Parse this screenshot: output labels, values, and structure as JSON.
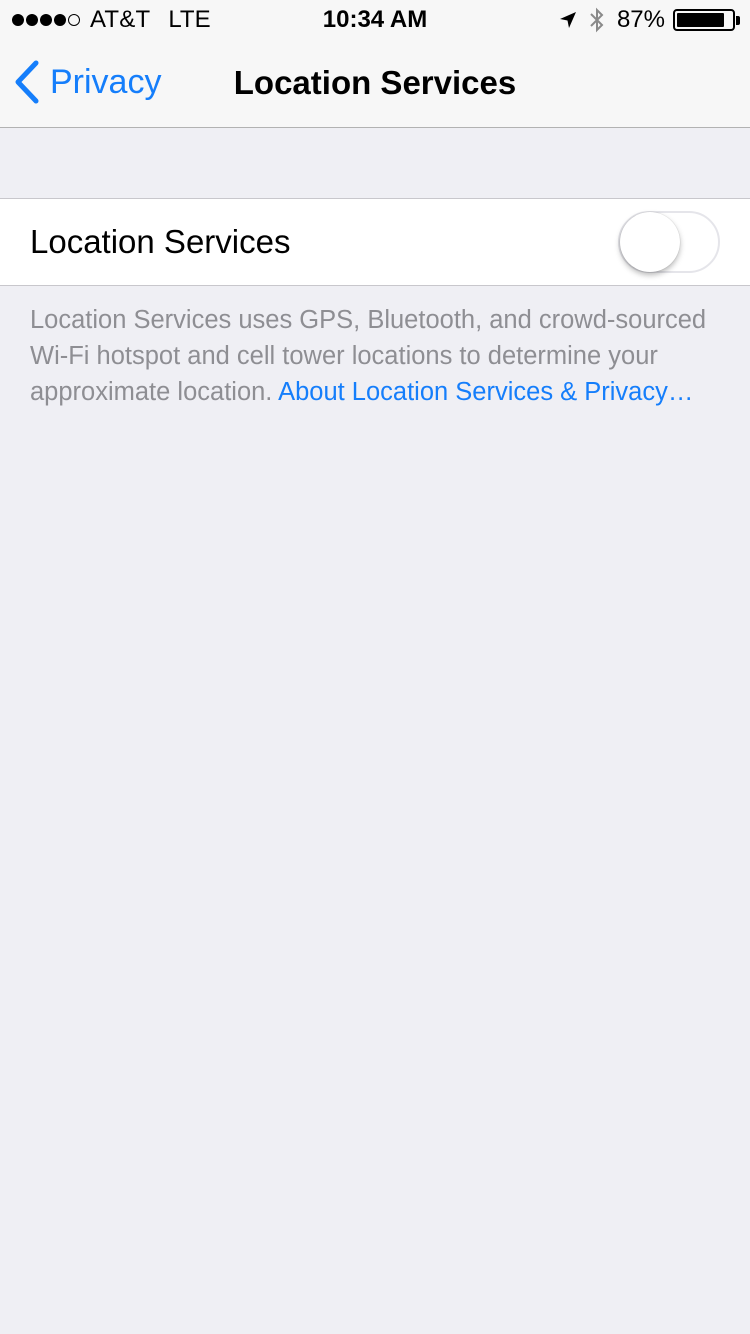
{
  "status_bar": {
    "signal_dots_filled": 4,
    "signal_dots_total": 5,
    "carrier": "AT&T",
    "network": "LTE",
    "time": "10:34 AM",
    "battery_percent_text": "87%",
    "battery_level": 0.87,
    "icons": [
      "location-arrow-icon",
      "bluetooth-icon",
      "battery-icon"
    ]
  },
  "nav": {
    "back_label": "Privacy",
    "title": "Location Services"
  },
  "setting": {
    "label": "Location Services",
    "toggle_on": false
  },
  "footer": {
    "text": "Location Services uses GPS, Bluetooth, and crowd-sourced Wi-Fi hotspot and cell tower locations to determine your approximate location. ",
    "link_text": "About Location Services & Privacy…"
  },
  "colors": {
    "accent": "#157efb",
    "background": "#efeff4",
    "footer_text": "#8e8e93"
  }
}
